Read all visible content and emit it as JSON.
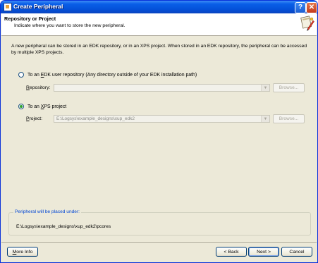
{
  "window": {
    "title": "Create Peripheral"
  },
  "titlebar_buttons": {
    "help": "?",
    "close": "✕"
  },
  "header": {
    "title": "Repository or Project",
    "subtitle": "Indicate where you want to store the new peripheral."
  },
  "description": "A new peripheral can be stored in an EDK repository, or in an XPS project. When stored in an EDK repository, the peripheral can be accessed by multiple XPS projects.",
  "options": {
    "repository": {
      "radio_label_pre": "To an ",
      "radio_label_u": "E",
      "radio_label_post": "DK user repository (Any directory outside of your EDK installation path)",
      "selected": false,
      "field_label_u": "R",
      "field_label_post": "epository:",
      "value": "",
      "browse_label": "Browse..."
    },
    "project": {
      "radio_label_pre": "To an ",
      "radio_label_u": "X",
      "radio_label_post": "PS project",
      "selected": true,
      "field_label_u": "P",
      "field_label_post": "roject:",
      "value": "E:\\Logsys\\example_designs\\xup_edk2",
      "browse_label": "Browse..."
    }
  },
  "placement": {
    "legend": "Peripheral will be placed under:",
    "path": "E:\\Logsys\\example_designs\\xup_edk2\\pcores"
  },
  "buttons": {
    "more_info_u": "M",
    "more_info_post": "ore Info",
    "back": "< Back",
    "next": "Next >",
    "cancel": "Cancel"
  },
  "colors": {
    "titlebar": "#0450d8",
    "dialog_bg": "#ece9d8",
    "legend_text": "#0046d5"
  }
}
